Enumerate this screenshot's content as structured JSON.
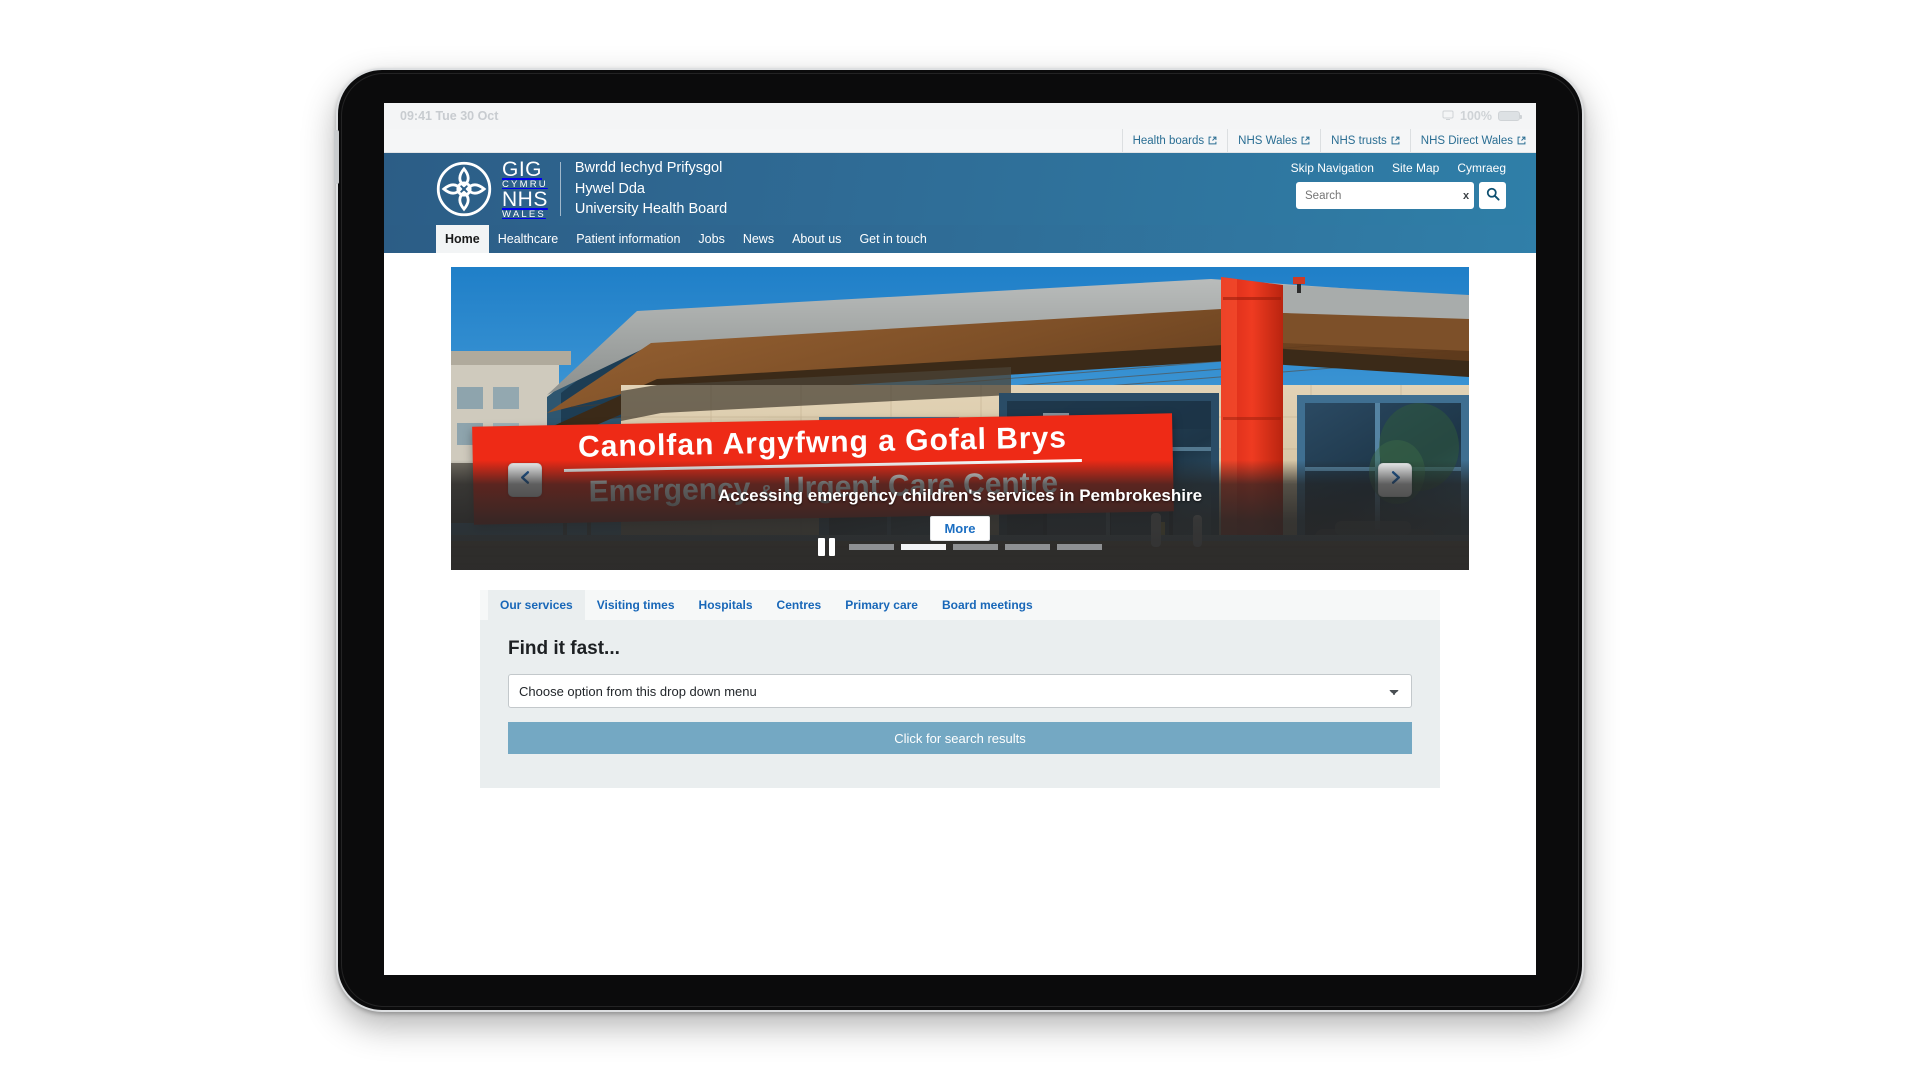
{
  "device": {
    "status_bar": {
      "time_date": "09:41  Tue 30 Oct",
      "battery_percent": "100%",
      "screen_mirror_icon": "screen-mirroring-icon"
    }
  },
  "utility_bar": {
    "links": [
      {
        "label": "Health boards",
        "icon": "external-link-icon"
      },
      {
        "label": "NHS Wales",
        "icon": "external-link-icon"
      },
      {
        "label": "NHS trusts",
        "icon": "external-link-icon"
      },
      {
        "label": "NHS Direct Wales",
        "icon": "external-link-icon"
      }
    ]
  },
  "header": {
    "logo": {
      "icon": "nhs-wales-celtic-knot-icon",
      "gig": "GIG",
      "cymru": "CYMRU",
      "nhs": "NHS",
      "wales": "WALES"
    },
    "organisation": {
      "line1": "Bwrdd Iechyd Prifysgol",
      "line2": "Hywel Dda",
      "line3": "University Health Board"
    },
    "quicklinks": [
      {
        "label": "Skip Navigation"
      },
      {
        "label": "Site Map"
      },
      {
        "label": "Cymraeg"
      }
    ],
    "search": {
      "value": "",
      "placeholder": "Search",
      "clear_label": "x",
      "submit_icon": "search-icon"
    }
  },
  "nav": {
    "items": [
      {
        "label": "Home",
        "active": true
      },
      {
        "label": "Healthcare",
        "active": false
      },
      {
        "label": "Patient information",
        "active": false
      },
      {
        "label": "Jobs",
        "active": false
      },
      {
        "label": "News",
        "active": false
      },
      {
        "label": "About us",
        "active": false
      },
      {
        "label": "Get in touch",
        "active": false
      }
    ]
  },
  "carousel": {
    "sign": {
      "welsh": "Canolfan Argyfwng a Gofal Brys",
      "english_prefix": "Emergency",
      "english_amp": "&",
      "english_suffix": "Urgent Care Centre"
    },
    "caption": "Accessing emergency children's services in Pembrokeshire",
    "more_label": "More",
    "prev_icon": "chevron-left-icon",
    "next_icon": "chevron-right-icon",
    "pause_icon": "pause-icon",
    "slide_count": 5,
    "active_slide": 2,
    "colors": {
      "sign_red": "#ee2a16",
      "sky_blue": "#2f8fd4",
      "accent_blue": "#1b6ec2"
    }
  },
  "finder": {
    "tabs": [
      {
        "label": "Our services",
        "active": true
      },
      {
        "label": "Visiting times",
        "active": false
      },
      {
        "label": "Hospitals",
        "active": false
      },
      {
        "label": "Centres",
        "active": false
      },
      {
        "label": "Primary care",
        "active": false
      },
      {
        "label": "Board meetings",
        "active": false
      }
    ],
    "title": "Find it fast...",
    "select": {
      "selected": "Choose option from this drop down menu",
      "options": [
        "Choose option from this drop down menu"
      ]
    },
    "submit_label": "Click for search results"
  },
  "theme": {
    "brand_dark_blue": "#2c5d86",
    "brand_light_blue": "#307fa9",
    "link_blue": "#2a6e93",
    "tab_blue": "#1867b8",
    "button_blue": "#74a8c3",
    "panel_grey": "#eaeeef"
  }
}
